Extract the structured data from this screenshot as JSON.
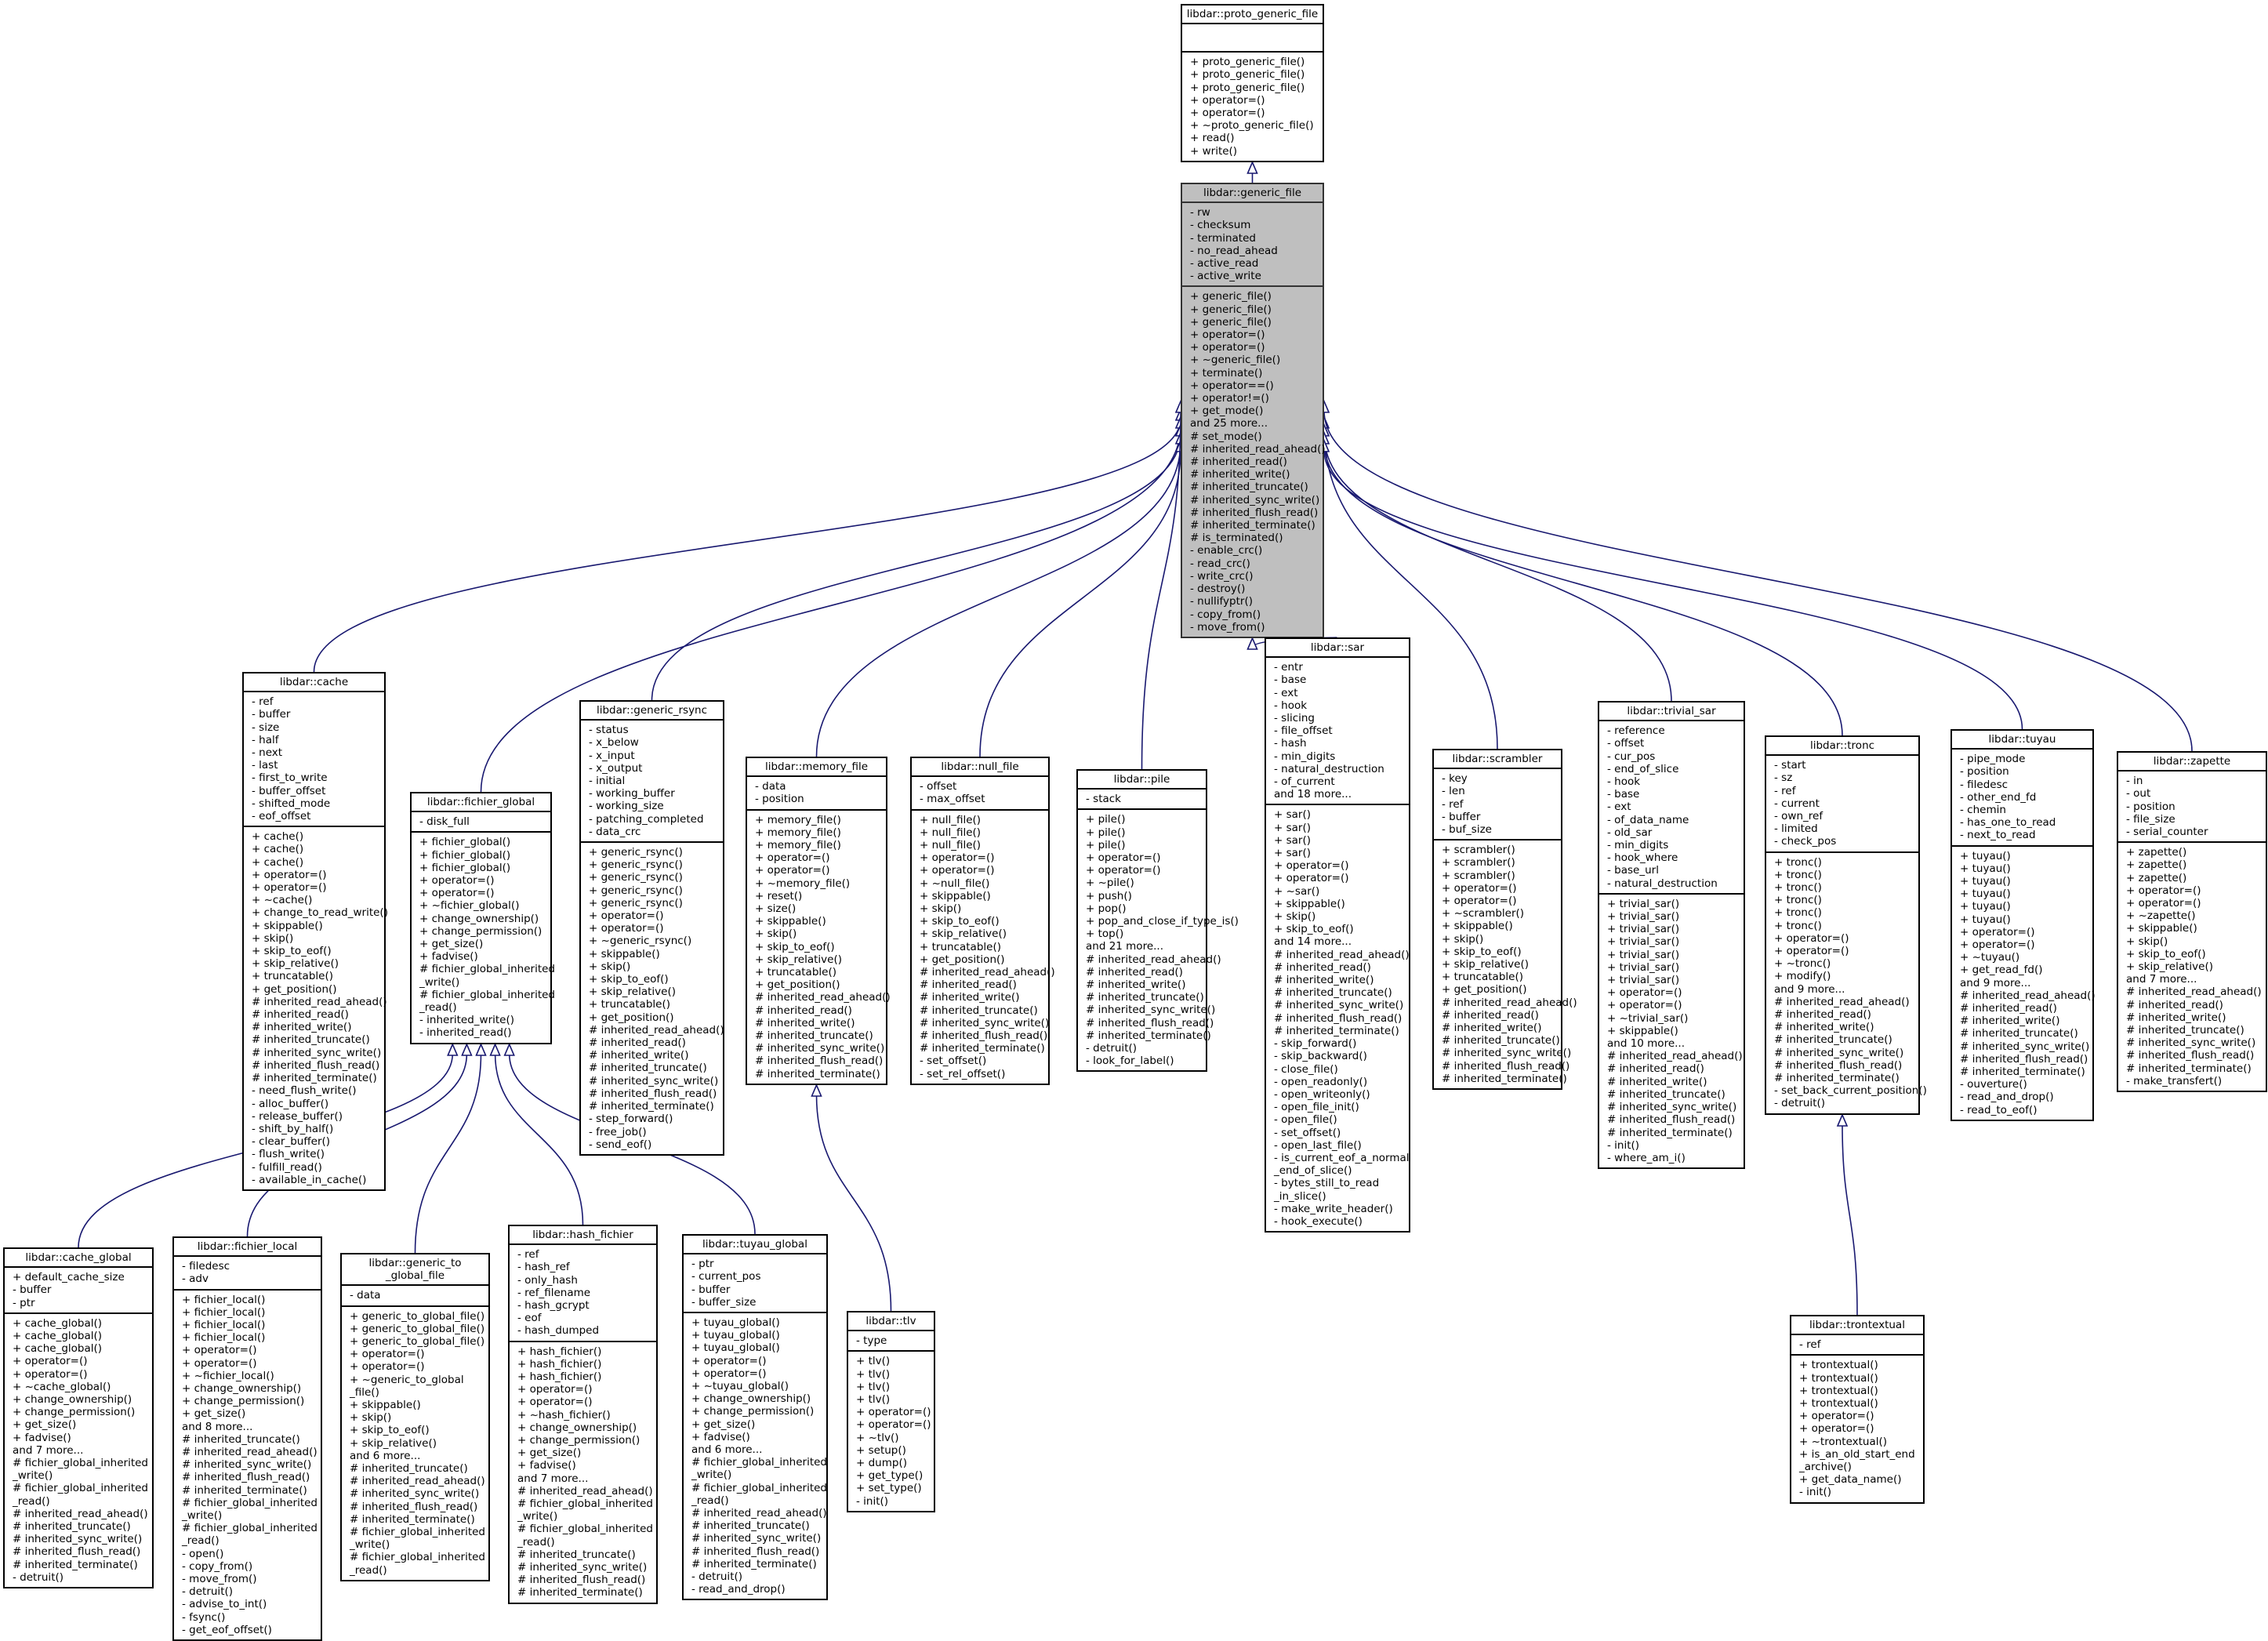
{
  "diagram": {
    "type": "class-inheritance",
    "focus_class": "libdar::generic_file",
    "colors": {
      "edge": "#191970",
      "focus_fill": "#bfbfbf",
      "node_fill": "#ffffff",
      "border": "#000000"
    }
  },
  "classes": [
    {
      "id": "proto_generic_file",
      "name": "libdar::proto_generic_file",
      "attributes": [],
      "methods": [
        "+ proto_generic_file()",
        "+ proto_generic_file()",
        "+ proto_generic_file()",
        "+ operator=()",
        "+ operator=()",
        "+ ~proto_generic_file()",
        "+ read()",
        "+ write()"
      ]
    },
    {
      "id": "generic_file",
      "name": "libdar::generic_file",
      "attributes": [
        "- rw",
        "- checksum",
        "- terminated",
        "- no_read_ahead",
        "- active_read",
        "- active_write"
      ],
      "methods": [
        "+ generic_file()",
        "+ generic_file()",
        "+ generic_file()",
        "+ operator=()",
        "+ operator=()",
        "+ ~generic_file()",
        "+ terminate()",
        "+ operator==()",
        "+ operator!=()",
        "+ get_mode()",
        "and 25 more...",
        "# set_mode()",
        "# inherited_read_ahead()",
        "# inherited_read()",
        "# inherited_write()",
        "# inherited_truncate()",
        "# inherited_sync_write()",
        "# inherited_flush_read()",
        "# inherited_terminate()",
        "# is_terminated()",
        "- enable_crc()",
        "- read_crc()",
        "- write_crc()",
        "- destroy()",
        "- nullifyptr()",
        "- copy_from()",
        "- move_from()"
      ]
    },
    {
      "id": "cache",
      "name": "libdar::cache",
      "attributes": [
        "- ref",
        "- buffer",
        "- size",
        "- half",
        "- next",
        "- last",
        "- first_to_write",
        "- buffer_offset",
        "- shifted_mode",
        "- eof_offset"
      ],
      "methods": [
        "+ cache()",
        "+ cache()",
        "+ cache()",
        "+ operator=()",
        "+ operator=()",
        "+ ~cache()",
        "+ change_to_read_write()",
        "+ skippable()",
        "+ skip()",
        "+ skip_to_eof()",
        "+ skip_relative()",
        "+ truncatable()",
        "+ get_position()",
        "# inherited_read_ahead()",
        "# inherited_read()",
        "# inherited_write()",
        "# inherited_truncate()",
        "# inherited_sync_write()",
        "# inherited_flush_read()",
        "# inherited_terminate()",
        "- need_flush_write()",
        "- alloc_buffer()",
        "- release_buffer()",
        "- shift_by_half()",
        "- clear_buffer()",
        "- flush_write()",
        "- fulfill_read()",
        "- available_in_cache()"
      ]
    },
    {
      "id": "fichier_global",
      "name": "libdar::fichier_global",
      "attributes": [
        "- disk_full"
      ],
      "methods": [
        "+ fichier_global()",
        "+ fichier_global()",
        "+ fichier_global()",
        "+ operator=()",
        "+ operator=()",
        "+ ~fichier_global()",
        "+ change_ownership()",
        "+ change_permission()",
        "+ get_size()",
        "+ fadvise()",
        "# fichier_global_inherited\n_write()",
        "# fichier_global_inherited\n_read()",
        "- inherited_write()",
        "- inherited_read()"
      ]
    },
    {
      "id": "generic_rsync",
      "name": "libdar::generic_rsync",
      "attributes": [
        "- status",
        "- x_below",
        "- x_input",
        "- x_output",
        "- initial",
        "- working_buffer",
        "- working_size",
        "- patching_completed",
        "- data_crc"
      ],
      "methods": [
        "+ generic_rsync()",
        "+ generic_rsync()",
        "+ generic_rsync()",
        "+ generic_rsync()",
        "+ generic_rsync()",
        "+ operator=()",
        "+ operator=()",
        "+ ~generic_rsync()",
        "+ skippable()",
        "+ skip()",
        "+ skip_to_eof()",
        "+ skip_relative()",
        "+ truncatable()",
        "+ get_position()",
        "# inherited_read_ahead()",
        "# inherited_read()",
        "# inherited_write()",
        "# inherited_truncate()",
        "# inherited_sync_write()",
        "# inherited_flush_read()",
        "# inherited_terminate()",
        "- step_forward()",
        "- free_job()",
        "- send_eof()"
      ]
    },
    {
      "id": "memory_file",
      "name": "libdar::memory_file",
      "attributes": [
        "- data",
        "- position"
      ],
      "methods": [
        "+ memory_file()",
        "+ memory_file()",
        "+ memory_file()",
        "+ operator=()",
        "+ operator=()",
        "+ ~memory_file()",
        "+ reset()",
        "+ size()",
        "+ skippable()",
        "+ skip()",
        "+ skip_to_eof()",
        "+ skip_relative()",
        "+ truncatable()",
        "+ get_position()",
        "# inherited_read_ahead()",
        "# inherited_read()",
        "# inherited_write()",
        "# inherited_truncate()",
        "# inherited_sync_write()",
        "# inherited_flush_read()",
        "# inherited_terminate()"
      ]
    },
    {
      "id": "null_file",
      "name": "libdar::null_file",
      "attributes": [
        "- offset",
        "- max_offset"
      ],
      "methods": [
        "+ null_file()",
        "+ null_file()",
        "+ null_file()",
        "+ operator=()",
        "+ operator=()",
        "+ ~null_file()",
        "+ skippable()",
        "+ skip()",
        "+ skip_to_eof()",
        "+ skip_relative()",
        "+ truncatable()",
        "+ get_position()",
        "# inherited_read_ahead()",
        "# inherited_read()",
        "# inherited_write()",
        "# inherited_truncate()",
        "# inherited_sync_write()",
        "# inherited_flush_read()",
        "# inherited_terminate()",
        "- set_offset()",
        "- set_rel_offset()"
      ]
    },
    {
      "id": "pile",
      "name": "libdar::pile",
      "attributes": [
        "- stack"
      ],
      "methods": [
        "+ pile()",
        "+ pile()",
        "+ pile()",
        "+ operator=()",
        "+ operator=()",
        "+ ~pile()",
        "+ push()",
        "+ pop()",
        "+ pop_and_close_if_type_is()",
        "+ top()",
        "and 21 more...",
        "# inherited_read_ahead()",
        "# inherited_read()",
        "# inherited_write()",
        "# inherited_truncate()",
        "# inherited_sync_write()",
        "# inherited_flush_read()",
        "# inherited_terminate()",
        "- detruit()",
        "- look_for_label()"
      ]
    },
    {
      "id": "sar",
      "name": "libdar::sar",
      "attributes": [
        "- entr",
        "- base",
        "- ext",
        "- hook",
        "- slicing",
        "- file_offset",
        "- hash",
        "- min_digits",
        "- natural_destruction",
        "- of_current",
        "and 18 more..."
      ],
      "methods": [
        "+ sar()",
        "+ sar()",
        "+ sar()",
        "+ sar()",
        "+ operator=()",
        "+ operator=()",
        "+ ~sar()",
        "+ skippable()",
        "+ skip()",
        "+ skip_to_eof()",
        "and 14 more...",
        "# inherited_read_ahead()",
        "# inherited_read()",
        "# inherited_write()",
        "# inherited_truncate()",
        "# inherited_sync_write()",
        "# inherited_flush_read()",
        "# inherited_terminate()",
        "- skip_forward()",
        "- skip_backward()",
        "- close_file()",
        "- open_readonly()",
        "- open_writeonly()",
        "- open_file_init()",
        "- open_file()",
        "- set_offset()",
        "- open_last_file()",
        "- is_current_eof_a_normal\n_end_of_slice()",
        "- bytes_still_to_read\n_in_slice()",
        "- make_write_header()",
        "- hook_execute()"
      ]
    },
    {
      "id": "scrambler",
      "name": "libdar::scrambler",
      "attributes": [
        "- key",
        "- len",
        "- ref",
        "- buffer",
        "- buf_size"
      ],
      "methods": [
        "+ scrambler()",
        "+ scrambler()",
        "+ scrambler()",
        "+ operator=()",
        "+ operator=()",
        "+ ~scrambler()",
        "+ skippable()",
        "+ skip()",
        "+ skip_to_eof()",
        "+ skip_relative()",
        "+ truncatable()",
        "+ get_position()",
        "# inherited_read_ahead()",
        "# inherited_read()",
        "# inherited_write()",
        "# inherited_truncate()",
        "# inherited_sync_write()",
        "# inherited_flush_read()",
        "# inherited_terminate()"
      ]
    },
    {
      "id": "trivial_sar",
      "name": "libdar::trivial_sar",
      "attributes": [
        "- reference",
        "- offset",
        "- cur_pos",
        "- end_of_slice",
        "- hook",
        "- base",
        "- ext",
        "- of_data_name",
        "- old_sar",
        "- min_digits",
        "- hook_where",
        "- base_url",
        "- natural_destruction"
      ],
      "methods": [
        "+ trivial_sar()",
        "+ trivial_sar()",
        "+ trivial_sar()",
        "+ trivial_sar()",
        "+ trivial_sar()",
        "+ trivial_sar()",
        "+ trivial_sar()",
        "+ operator=()",
        "+ operator=()",
        "+ ~trivial_sar()",
        "+ skippable()",
        "and 10 more...",
        "# inherited_read_ahead()",
        "# inherited_read()",
        "# inherited_write()",
        "# inherited_truncate()",
        "# inherited_sync_write()",
        "# inherited_flush_read()",
        "# inherited_terminate()",
        "- init()",
        "- where_am_i()"
      ]
    },
    {
      "id": "tronc",
      "name": "libdar::tronc",
      "attributes": [
        "- start",
        "- sz",
        "- ref",
        "- current",
        "- own_ref",
        "- limited",
        "- check_pos"
      ],
      "methods": [
        "+ tronc()",
        "+ tronc()",
        "+ tronc()",
        "+ tronc()",
        "+ tronc()",
        "+ tronc()",
        "+ operator=()",
        "+ operator=()",
        "+ ~tronc()",
        "+ modify()",
        "and 9 more...",
        "# inherited_read_ahead()",
        "# inherited_read()",
        "# inherited_write()",
        "# inherited_truncate()",
        "# inherited_sync_write()",
        "# inherited_flush_read()",
        "# inherited_terminate()",
        "- set_back_current_position()",
        "- detruit()"
      ]
    },
    {
      "id": "tuyau",
      "name": "libdar::tuyau",
      "attributes": [
        "- pipe_mode",
        "- position",
        "- filedesc",
        "- other_end_fd",
        "- chemin",
        "- has_one_to_read",
        "- next_to_read"
      ],
      "methods": [
        "+ tuyau()",
        "+ tuyau()",
        "+ tuyau()",
        "+ tuyau()",
        "+ tuyau()",
        "+ tuyau()",
        "+ operator=()",
        "+ operator=()",
        "+ ~tuyau()",
        "+ get_read_fd()",
        "and 9 more...",
        "# inherited_read_ahead()",
        "# inherited_read()",
        "# inherited_write()",
        "# inherited_truncate()",
        "# inherited_sync_write()",
        "# inherited_flush_read()",
        "# inherited_terminate()",
        "- ouverture()",
        "- read_and_drop()",
        "- read_to_eof()"
      ]
    },
    {
      "id": "zapette",
      "name": "libdar::zapette",
      "attributes": [
        "- in",
        "- out",
        "- position",
        "- file_size",
        "- serial_counter"
      ],
      "methods": [
        "+ zapette()",
        "+ zapette()",
        "+ zapette()",
        "+ operator=()",
        "+ operator=()",
        "+ ~zapette()",
        "+ skippable()",
        "+ skip()",
        "+ skip_to_eof()",
        "+ skip_relative()",
        "and 7 more...",
        "# inherited_read_ahead()",
        "# inherited_read()",
        "# inherited_write()",
        "# inherited_truncate()",
        "# inherited_sync_write()",
        "# inherited_flush_read()",
        "# inherited_terminate()",
        "- make_transfert()"
      ]
    },
    {
      "id": "cache_global",
      "name": "libdar::cache_global",
      "attributes": [
        "+ default_cache_size",
        "- buffer",
        "- ptr"
      ],
      "methods": [
        "+ cache_global()",
        "+ cache_global()",
        "+ cache_global()",
        "+ operator=()",
        "+ operator=()",
        "+ ~cache_global()",
        "+ change_ownership()",
        "+ change_permission()",
        "+ get_size()",
        "+ fadvise()",
        "and 7 more...",
        "# fichier_global_inherited\n_write()",
        "# fichier_global_inherited\n_read()",
        "# inherited_read_ahead()",
        "# inherited_truncate()",
        "# inherited_sync_write()",
        "# inherited_flush_read()",
        "# inherited_terminate()",
        "- detruit()"
      ]
    },
    {
      "id": "fichier_local",
      "name": "libdar::fichier_local",
      "attributes": [
        "- filedesc",
        "- adv"
      ],
      "methods": [
        "+ fichier_local()",
        "+ fichier_local()",
        "+ fichier_local()",
        "+ fichier_local()",
        "+ operator=()",
        "+ operator=()",
        "+ ~fichier_local()",
        "+ change_ownership()",
        "+ change_permission()",
        "+ get_size()",
        "and 8 more...",
        "# inherited_truncate()",
        "# inherited_read_ahead()",
        "# inherited_sync_write()",
        "# inherited_flush_read()",
        "# inherited_terminate()",
        "# fichier_global_inherited\n_write()",
        "# fichier_global_inherited\n_read()",
        "- open()",
        "- copy_from()",
        "- move_from()",
        "- detruit()",
        "- advise_to_int()",
        "- fsync()",
        "- get_eof_offset()"
      ]
    },
    {
      "id": "generic_to_global_file",
      "name": "libdar::generic_to\n_global_file",
      "attributes": [
        "- data"
      ],
      "methods": [
        "+ generic_to_global_file()",
        "+ generic_to_global_file()",
        "+ generic_to_global_file()",
        "+ operator=()",
        "+ operator=()",
        "+ ~generic_to_global\n_file()",
        "+ skippable()",
        "+ skip()",
        "+ skip_to_eof()",
        "+ skip_relative()",
        "and 6 more...",
        "# inherited_truncate()",
        "# inherited_read_ahead()",
        "# inherited_sync_write()",
        "# inherited_flush_read()",
        "# inherited_terminate()",
        "# fichier_global_inherited\n_write()",
        "# fichier_global_inherited\n_read()"
      ]
    },
    {
      "id": "hash_fichier",
      "name": "libdar::hash_fichier",
      "attributes": [
        "- ref",
        "- hash_ref",
        "- only_hash",
        "- ref_filename",
        "- hash_gcrypt",
        "- eof",
        "- hash_dumped"
      ],
      "methods": [
        "+ hash_fichier()",
        "+ hash_fichier()",
        "+ hash_fichier()",
        "+ operator=()",
        "+ operator=()",
        "+ ~hash_fichier()",
        "+ change_ownership()",
        "+ change_permission()",
        "+ get_size()",
        "+ fadvise()",
        "and 7 more...",
        "# inherited_read_ahead()",
        "# fichier_global_inherited\n_write()",
        "# fichier_global_inherited\n_read()",
        "# inherited_truncate()",
        "# inherited_sync_write()",
        "# inherited_flush_read()",
        "# inherited_terminate()"
      ]
    },
    {
      "id": "tuyau_global",
      "name": "libdar::tuyau_global",
      "attributes": [
        "- ptr",
        "- current_pos",
        "- buffer",
        "- buffer_size"
      ],
      "methods": [
        "+ tuyau_global()",
        "+ tuyau_global()",
        "+ tuyau_global()",
        "+ operator=()",
        "+ operator=()",
        "+ ~tuyau_global()",
        "+ change_ownership()",
        "+ change_permission()",
        "+ get_size()",
        "+ fadvise()",
        "and 6 more...",
        "# fichier_global_inherited\n_write()",
        "# fichier_global_inherited\n_read()",
        "# inherited_read_ahead()",
        "# inherited_truncate()",
        "# inherited_sync_write()",
        "# inherited_flush_read()",
        "# inherited_terminate()",
        "- detruit()",
        "- read_and_drop()"
      ]
    },
    {
      "id": "tlv",
      "name": "libdar::tlv",
      "attributes": [
        "- type"
      ],
      "methods": [
        "+ tlv()",
        "+ tlv()",
        "+ tlv()",
        "+ tlv()",
        "+ operator=()",
        "+ operator=()",
        "+ ~tlv()",
        "+ setup()",
        "+ dump()",
        "+ get_type()",
        "+ set_type()",
        "- init()"
      ]
    },
    {
      "id": "trontextual",
      "name": "libdar::trontextual",
      "attributes": [
        "- ref"
      ],
      "methods": [
        "+ trontextual()",
        "+ trontextual()",
        "+ trontextual()",
        "+ trontextual()",
        "+ operator=()",
        "+ operator=()",
        "+ ~trontextual()",
        "+ is_an_old_start_end\n_archive()",
        "+ get_data_name()",
        "- init()"
      ]
    }
  ],
  "inheritance": [
    {
      "child": "generic_file",
      "parent": "proto_generic_file"
    },
    {
      "child": "cache",
      "parent": "generic_file"
    },
    {
      "child": "fichier_global",
      "parent": "generic_file"
    },
    {
      "child": "generic_rsync",
      "parent": "generic_file"
    },
    {
      "child": "memory_file",
      "parent": "generic_file"
    },
    {
      "child": "null_file",
      "parent": "generic_file"
    },
    {
      "child": "pile",
      "parent": "generic_file"
    },
    {
      "child": "sar",
      "parent": "generic_file"
    },
    {
      "child": "scrambler",
      "parent": "generic_file"
    },
    {
      "child": "trivial_sar",
      "parent": "generic_file"
    },
    {
      "child": "tronc",
      "parent": "generic_file"
    },
    {
      "child": "tuyau",
      "parent": "generic_file"
    },
    {
      "child": "zapette",
      "parent": "generic_file"
    },
    {
      "child": "cache_global",
      "parent": "fichier_global"
    },
    {
      "child": "fichier_local",
      "parent": "fichier_global"
    },
    {
      "child": "generic_to_global_file",
      "parent": "fichier_global"
    },
    {
      "child": "hash_fichier",
      "parent": "fichier_global"
    },
    {
      "child": "tuyau_global",
      "parent": "fichier_global"
    },
    {
      "child": "tlv",
      "parent": "memory_file"
    },
    {
      "child": "trontextual",
      "parent": "tronc"
    }
  ]
}
